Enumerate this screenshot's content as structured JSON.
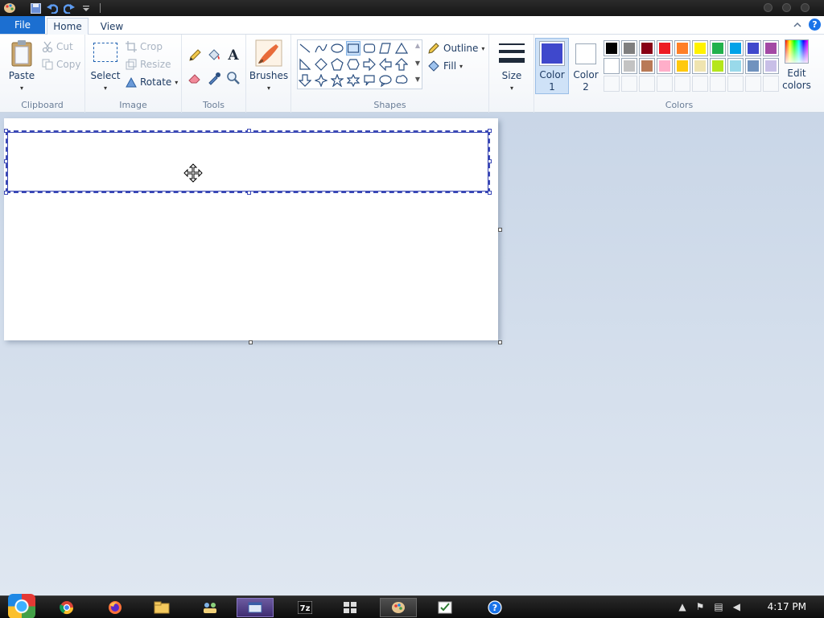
{
  "quick_access": {
    "app_icon": "paint-palette-icon",
    "save_icon": "save-icon",
    "undo_icon": "undo-icon",
    "redo_icon": "redo-icon"
  },
  "tabs": {
    "file": "File",
    "home": "Home",
    "view": "View"
  },
  "help_label": "?",
  "clipboard": {
    "paste": "Paste",
    "cut": "Cut",
    "copy": "Copy",
    "group": "Clipboard"
  },
  "image": {
    "select": "Select",
    "crop": "Crop",
    "resize": "Resize",
    "rotate": "Rotate",
    "group": "Image"
  },
  "tools": {
    "group": "Tools",
    "text_tool": "A"
  },
  "brushes": {
    "label": "Brushes"
  },
  "shapes": {
    "outline": "Outline",
    "fill": "Fill",
    "group": "Shapes"
  },
  "size": {
    "label": "Size"
  },
  "colors": {
    "color1_line1": "Color",
    "color1_line2": "1",
    "color2_line1": "Color",
    "color2_line2": "2",
    "edit_line1": "Edit",
    "edit_line2": "colors",
    "group": "Colors",
    "color1_value": "#3f48cc",
    "color2_value": "#ffffff",
    "palette": [
      "#000000",
      "#7f7f7f",
      "#880015",
      "#ed1c24",
      "#ff7f27",
      "#fff200",
      "#22b14c",
      "#00a2e8",
      "#3f48cc",
      "#a349a4",
      "#ffffff",
      "#c3c3c3",
      "#b97a57",
      "#ffaec9",
      "#ffc90e",
      "#efe4b0",
      "#b5e61d",
      "#99d9ea",
      "#7092be",
      "#c8bfe7",
      "",
      "",
      "",
      "",
      "",
      "",
      "",
      "",
      "",
      ""
    ]
  },
  "taskbar": {
    "clock": "4:17 PM",
    "items": [
      "chrome",
      "firefox",
      "explorer",
      "network",
      "paint-window",
      "7zip",
      "task-switcher",
      "paint",
      "tasks",
      "help"
    ]
  }
}
